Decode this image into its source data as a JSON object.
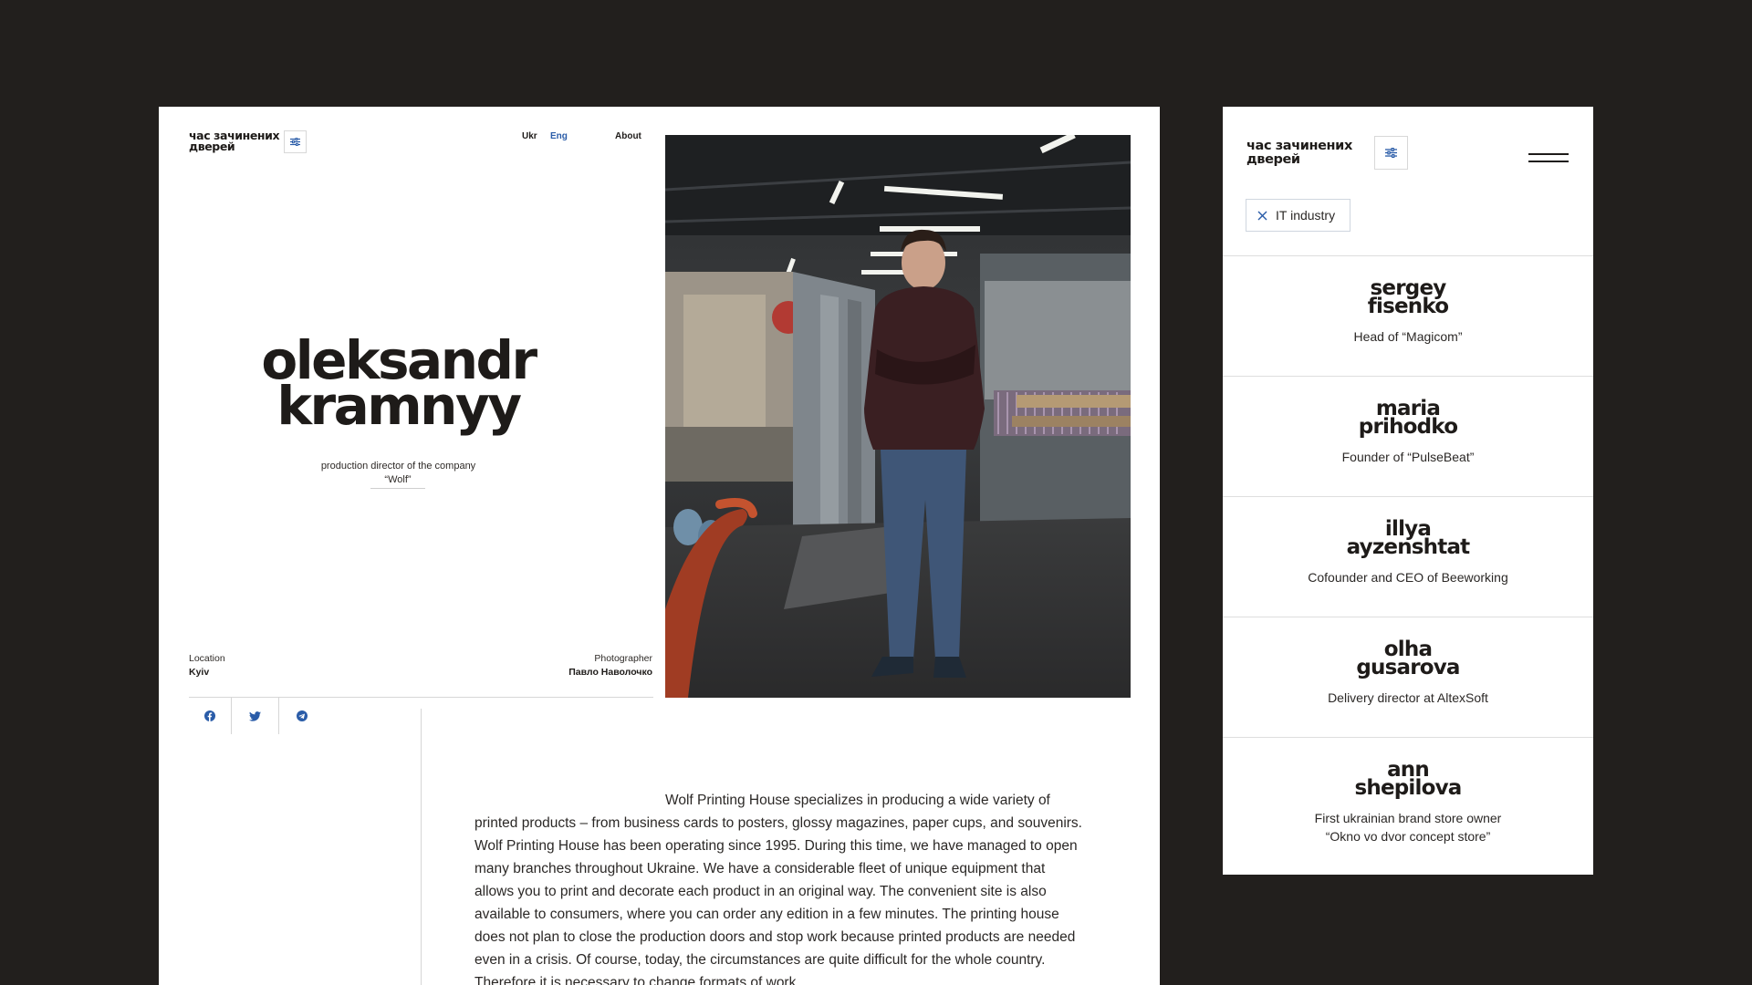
{
  "brand": {
    "logo_line1": "час зачинених",
    "logo_line2": "дверей"
  },
  "nav": {
    "lang_ukr": "Ukr",
    "lang_eng": "Eng",
    "about": "About",
    "active_lang": "Eng"
  },
  "profile": {
    "name_line1": "oleksandr",
    "name_line2": "kramnyy",
    "role": "production director of the company",
    "company": "“Wolf”",
    "location_label": "Location",
    "location_value": "Kyiv",
    "photographer_label": "Photographer",
    "photographer_value": "Павло Наволочко"
  },
  "share": [
    {
      "icon": "facebook-icon"
    },
    {
      "icon": "twitter-icon"
    },
    {
      "icon": "telegram-icon"
    }
  ],
  "article": {
    "text": "Wolf Printing House specializes in producing a wide variety of printed products – from business cards to posters, glossy magazines, paper cups, and souvenirs. Wolf Printing House has been operating since 1995. During this time, we have managed to open many branches throughout Ukraine. We have a considerable fleet of unique equipment that allows you to print and decorate each product in an original way. The convenient site is also available to consumers, where you can order any edition in a few minutes. The printing house does not plan to close the production doors and stop work because printed products are needed even in a crisis. Of course, today, the circumstances are quite difficult for the whole country. Therefore it is necessary to change formats of work."
  },
  "sidebar": {
    "filter_tag": "IT industry",
    "people": [
      {
        "name_line1": "sergey",
        "name_line2": "fisenko",
        "role": "Head of “Magicom”"
      },
      {
        "name_line1": "maria",
        "name_line2": "prihodko",
        "role": "Founder of “PulseBeat”"
      },
      {
        "name_line1": "illya",
        "name_line2": "ayzenshtat",
        "role": "Cofounder and CEO of Beeworking"
      },
      {
        "name_line1": "olha",
        "name_line2": "gusarova",
        "role": "Delivery director at AltexSoft"
      },
      {
        "name_line1": "ann",
        "name_line2": "shepilova",
        "role": "First ukrainian brand store owner\n“Okno vo dvor concept store”"
      }
    ]
  },
  "colors": {
    "background": "#221f1d",
    "accent": "#2a5ca8",
    "text": "#1e1b19"
  }
}
